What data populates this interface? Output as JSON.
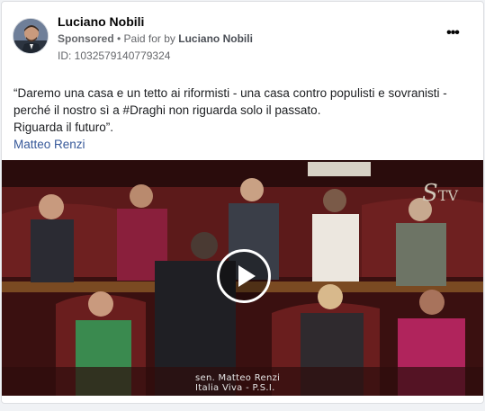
{
  "post": {
    "page_name": "Luciano Nobili",
    "sponsored_label": "Sponsored",
    "separator": " • ",
    "paid_for_prefix": "Paid for by ",
    "paid_for_name": "Luciano Nobili",
    "ad_id": "ID: 1032579140779324",
    "more_icon": "more-dots-icon",
    "text_lines": [
      "“Daremo una casa e un tetto ai riformisti - una casa contro populisti e sovranisti -",
      "perché il nostro sì a #Draghi non riguarda solo il passato.",
      "Riguarda il futuro”."
    ],
    "author": "Matteo Renzi"
  },
  "video": {
    "play_icon": "play-icon",
    "channel_logo_s": "S",
    "channel_logo_tv": "TV",
    "caption_line1": "sen. Matteo Renzi",
    "caption_line2": "Italia Viva - P.S.I."
  },
  "colors": {
    "link": "#365899",
    "text": "#1c1e21",
    "secondary": "#65676b"
  }
}
